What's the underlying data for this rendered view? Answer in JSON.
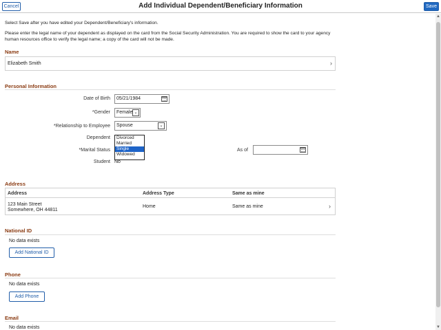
{
  "header": {
    "title": "Add Individual Dependent/Beneficiary Information",
    "cancel_label": "Cancel",
    "save_label": "Save"
  },
  "intro": {
    "line1": "Select Save after you have edited your Dependent/Beneficiary's information.",
    "line2": "Please enter the legal name of your dependent as displayed on the card from the Social Security Administration. You are required to show the card to your agency human resources office to verify the legal name; a copy of the card will not be made."
  },
  "name_section": {
    "title": "Name",
    "value": "Elizabeth Smith"
  },
  "personal": {
    "title": "Personal Information",
    "dob_label": "Date of Birth",
    "dob_value": "05/21/1984",
    "gender_label": "*Gender",
    "gender_value": "Female",
    "relationship_label": "*Relationship to Employee",
    "relationship_value": "Spouse",
    "dependent_label": "Dependent",
    "marital_label": "*Marital Status",
    "marital_options": [
      "Divorced",
      "Married",
      "Single",
      "Widowed"
    ],
    "marital_selected": "Single",
    "as_of_label": "As of",
    "as_of_value": "",
    "student_label": "Student",
    "student_value": "No"
  },
  "address": {
    "title": "Address",
    "columns": [
      "Address",
      "Address Type",
      "Same as mine"
    ],
    "rows": [
      {
        "address_line1": "123 Main Street",
        "address_line2": "Somewhere, OH 44811",
        "type": "Home",
        "same": "Same as mine"
      }
    ]
  },
  "national_id": {
    "title": "National ID",
    "empty": "No data exists",
    "add_label": "Add National ID"
  },
  "phone": {
    "title": "Phone",
    "empty": "No data exists",
    "add_label": "Add Phone"
  },
  "email": {
    "title": "Email",
    "empty": "No data exists"
  },
  "colors": {
    "accent": "#1f68c1",
    "section_title": "#8a3b12",
    "selected_option": "#1e64c8"
  }
}
